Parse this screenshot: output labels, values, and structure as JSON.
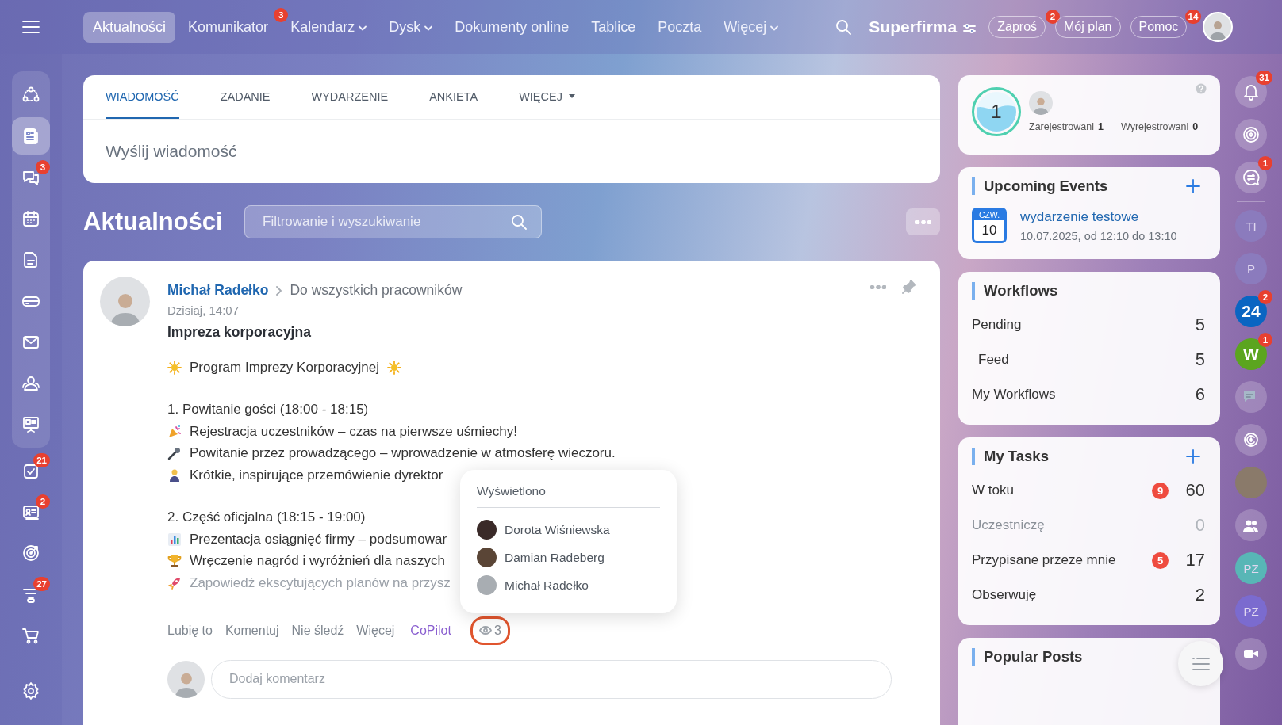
{
  "top_nav": {
    "items": [
      {
        "label": "Aktualności",
        "selected": true
      },
      {
        "label": "Komunikator",
        "selected": false,
        "badge": "3"
      },
      {
        "label": "Kalendarz",
        "selected": false,
        "dropdown": true
      },
      {
        "label": "Dysk",
        "selected": false,
        "dropdown": true
      },
      {
        "label": "Dokumenty online",
        "selected": false
      },
      {
        "label": "Tablice",
        "selected": false
      },
      {
        "label": "Poczta",
        "selected": false
      },
      {
        "label": "Więcej",
        "selected": false,
        "dropdown": true
      }
    ],
    "company": "Superfirma",
    "buttons": [
      {
        "label": "Zaproś",
        "badge": "2"
      },
      {
        "label": "Mój plan"
      },
      {
        "label": "Pomoc",
        "badge": "14"
      }
    ]
  },
  "sidebar": {
    "pinned_items": [
      {
        "selected": false
      },
      {
        "selected": true
      },
      {
        "selected": false,
        "badge": "3"
      },
      {
        "selected": false
      },
      {
        "selected": false
      },
      {
        "selected": false
      },
      {
        "selected": false
      },
      {
        "selected": false
      },
      {
        "selected": false
      }
    ],
    "items": [
      {
        "selected": false,
        "badge": "21"
      },
      {
        "selected": false,
        "badge": "2"
      },
      {
        "selected": false
      },
      {
        "selected": false,
        "badge": "27"
      },
      {
        "selected": false
      }
    ]
  },
  "composer": {
    "tabs": [
      {
        "label": "WIADOMOŚĆ",
        "selected": true
      },
      {
        "label": "ZADANIE",
        "selected": false
      },
      {
        "label": "WYDARZENIE",
        "selected": false
      },
      {
        "label": "ANKIETA",
        "selected": false
      },
      {
        "label": "WIĘCEJ",
        "selected": false,
        "dropdown": true
      }
    ],
    "placeholder": "Wyślij wiadomość"
  },
  "feed": {
    "title": "Aktualności",
    "filter_placeholder": "Filtrowanie i wyszukiwanie"
  },
  "post": {
    "author": "Michał Radełko",
    "destination": "Do wszystkich pracowników",
    "time": "Dzisiaj, 14:07",
    "title": "Impreza korporacyjna",
    "body": [
      {
        "kind": "headline",
        "text": "Program Imprezy Korporacyjnej"
      },
      {
        "kind": "blank"
      },
      {
        "kind": "section",
        "text": "1. Powitanie gości (18:00 - 18:15)"
      },
      {
        "kind": "bullet",
        "text": "Rejestracja uczestników – czas na pierwsze uśmiechy!"
      },
      {
        "kind": "bullet",
        "text": "Powitanie przez prowadzącego – wprowadzenie w atmosferę wieczoru."
      },
      {
        "kind": "bullet",
        "text": "Krótkie, inspirujące przemówienie dyrektor"
      },
      {
        "kind": "blank"
      },
      {
        "kind": "section",
        "text": "2. Część oficjalna (18:15 - 19:00)"
      },
      {
        "kind": "bullet",
        "text": "Prezentacja osiągnięć firmy – podsumowar"
      },
      {
        "kind": "bullet",
        "text": "Wręczenie nagród i wyróżnień dla naszych"
      },
      {
        "kind": "faded",
        "text": "Zapowiedź ekscytujących planów na przysz"
      }
    ],
    "actions": [
      {
        "label": "Lubię to",
        "kind": "link"
      },
      {
        "label": "Komentuj",
        "kind": "link"
      },
      {
        "label": "Nie śledź",
        "kind": "link"
      },
      {
        "label": "Więcej",
        "kind": "link"
      },
      {
        "label": "CoPilot",
        "kind": "ai"
      }
    ],
    "views": {
      "count": "3",
      "highlighted": true
    },
    "views_popup": {
      "title": "Wyświetlono",
      "viewers": [
        "Dorota Wiśniewska",
        "Damian Radeberg",
        "Michał Radełko"
      ]
    },
    "comment_placeholder": "Dodaj komentarz"
  },
  "presence": {
    "count": "1",
    "stats": [
      {
        "label": "Zarejestrowani",
        "value": "1"
      },
      {
        "label": "Wyrejestrowani",
        "value": "0"
      }
    ]
  },
  "events": {
    "title": "Upcoming Events",
    "items": [
      {
        "day": "CZW.",
        "date": "10",
        "title": "wydarzenie testowe",
        "time": "10.07.2025, od 12:10 do 13:10"
      }
    ]
  },
  "workflows": {
    "title": "Workflows",
    "rows": [
      {
        "label": "Pending",
        "count": "5",
        "children": [
          {
            "label": "Feed",
            "count": "5"
          }
        ]
      },
      {
        "label": "My Workflows",
        "count": "6"
      }
    ]
  },
  "tasks": {
    "title": "My Tasks",
    "rows": [
      {
        "label": "W toku",
        "count": "60",
        "badge": "9",
        "muted": false
      },
      {
        "label": "Uczestniczę",
        "count": "0",
        "muted": true
      },
      {
        "label": "Przypisane przeze mnie",
        "count": "17",
        "badge": "5",
        "muted": false
      },
      {
        "label": "Obserwuję",
        "count": "2",
        "muted": false
      }
    ]
  },
  "popular": {
    "title": "Popular Posts"
  },
  "rail": [
    {
      "kind": "icon",
      "badge": "31"
    },
    {
      "kind": "icon"
    },
    {
      "kind": "icon",
      "badge": "1"
    },
    {
      "kind": "divider"
    },
    {
      "kind": "initials",
      "text": "TI",
      "color": "#8b7bbd"
    },
    {
      "kind": "initials",
      "text": "P",
      "color": "#8b7bbd"
    },
    {
      "kind": "logo",
      "text": "24",
      "badge": "2",
      "color": "#0a65c2"
    },
    {
      "kind": "logo",
      "text": "W",
      "badge": "1",
      "color": "#5ba51f"
    },
    {
      "kind": "icon"
    },
    {
      "kind": "icon"
    },
    {
      "kind": "photo"
    },
    {
      "kind": "icon"
    },
    {
      "kind": "initials",
      "text": "PZ",
      "color": "#58b6b6"
    },
    {
      "kind": "initials",
      "text": "PZ",
      "color": "#7b6bcf"
    },
    {
      "kind": "icon"
    }
  ]
}
